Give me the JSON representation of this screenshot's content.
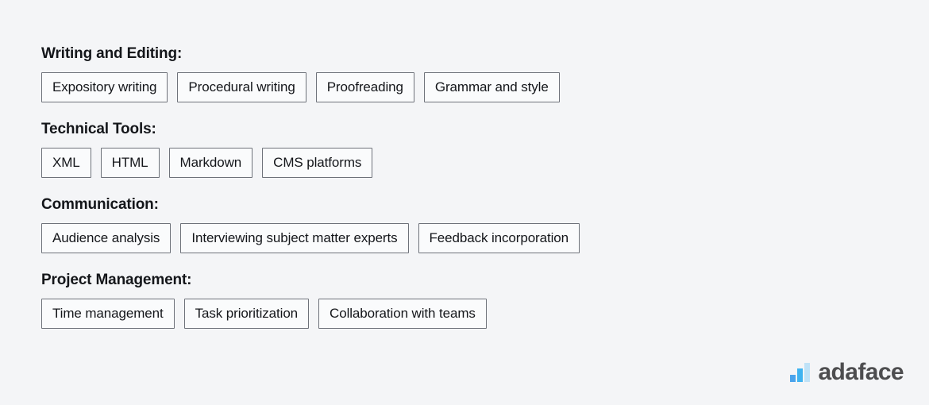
{
  "page": {
    "background_color": "#f4f5f7"
  },
  "skill_groups": [
    {
      "heading": "Writing and Editing:",
      "tags": [
        "Expository writing",
        "Procedural writing",
        "Proofreading",
        "Grammar and style"
      ]
    },
    {
      "heading": "Technical Tools:",
      "tags": [
        "XML",
        "HTML",
        "Markdown",
        "CMS platforms"
      ]
    },
    {
      "heading": "Communication:",
      "tags": [
        "Audience analysis",
        "Interviewing subject matter experts",
        "Feedback incorporation"
      ]
    },
    {
      "heading": "Project Management:",
      "tags": [
        "Time management",
        "Task prioritization",
        "Collaboration with teams"
      ]
    }
  ],
  "brand": {
    "name": "adaface",
    "mark_icon": "bar-chart-logo-icon",
    "text_color": "#4d4d4f",
    "bar_colors": [
      "#4aa3ec",
      "#3fb3f0",
      "#bfe2f7"
    ]
  }
}
